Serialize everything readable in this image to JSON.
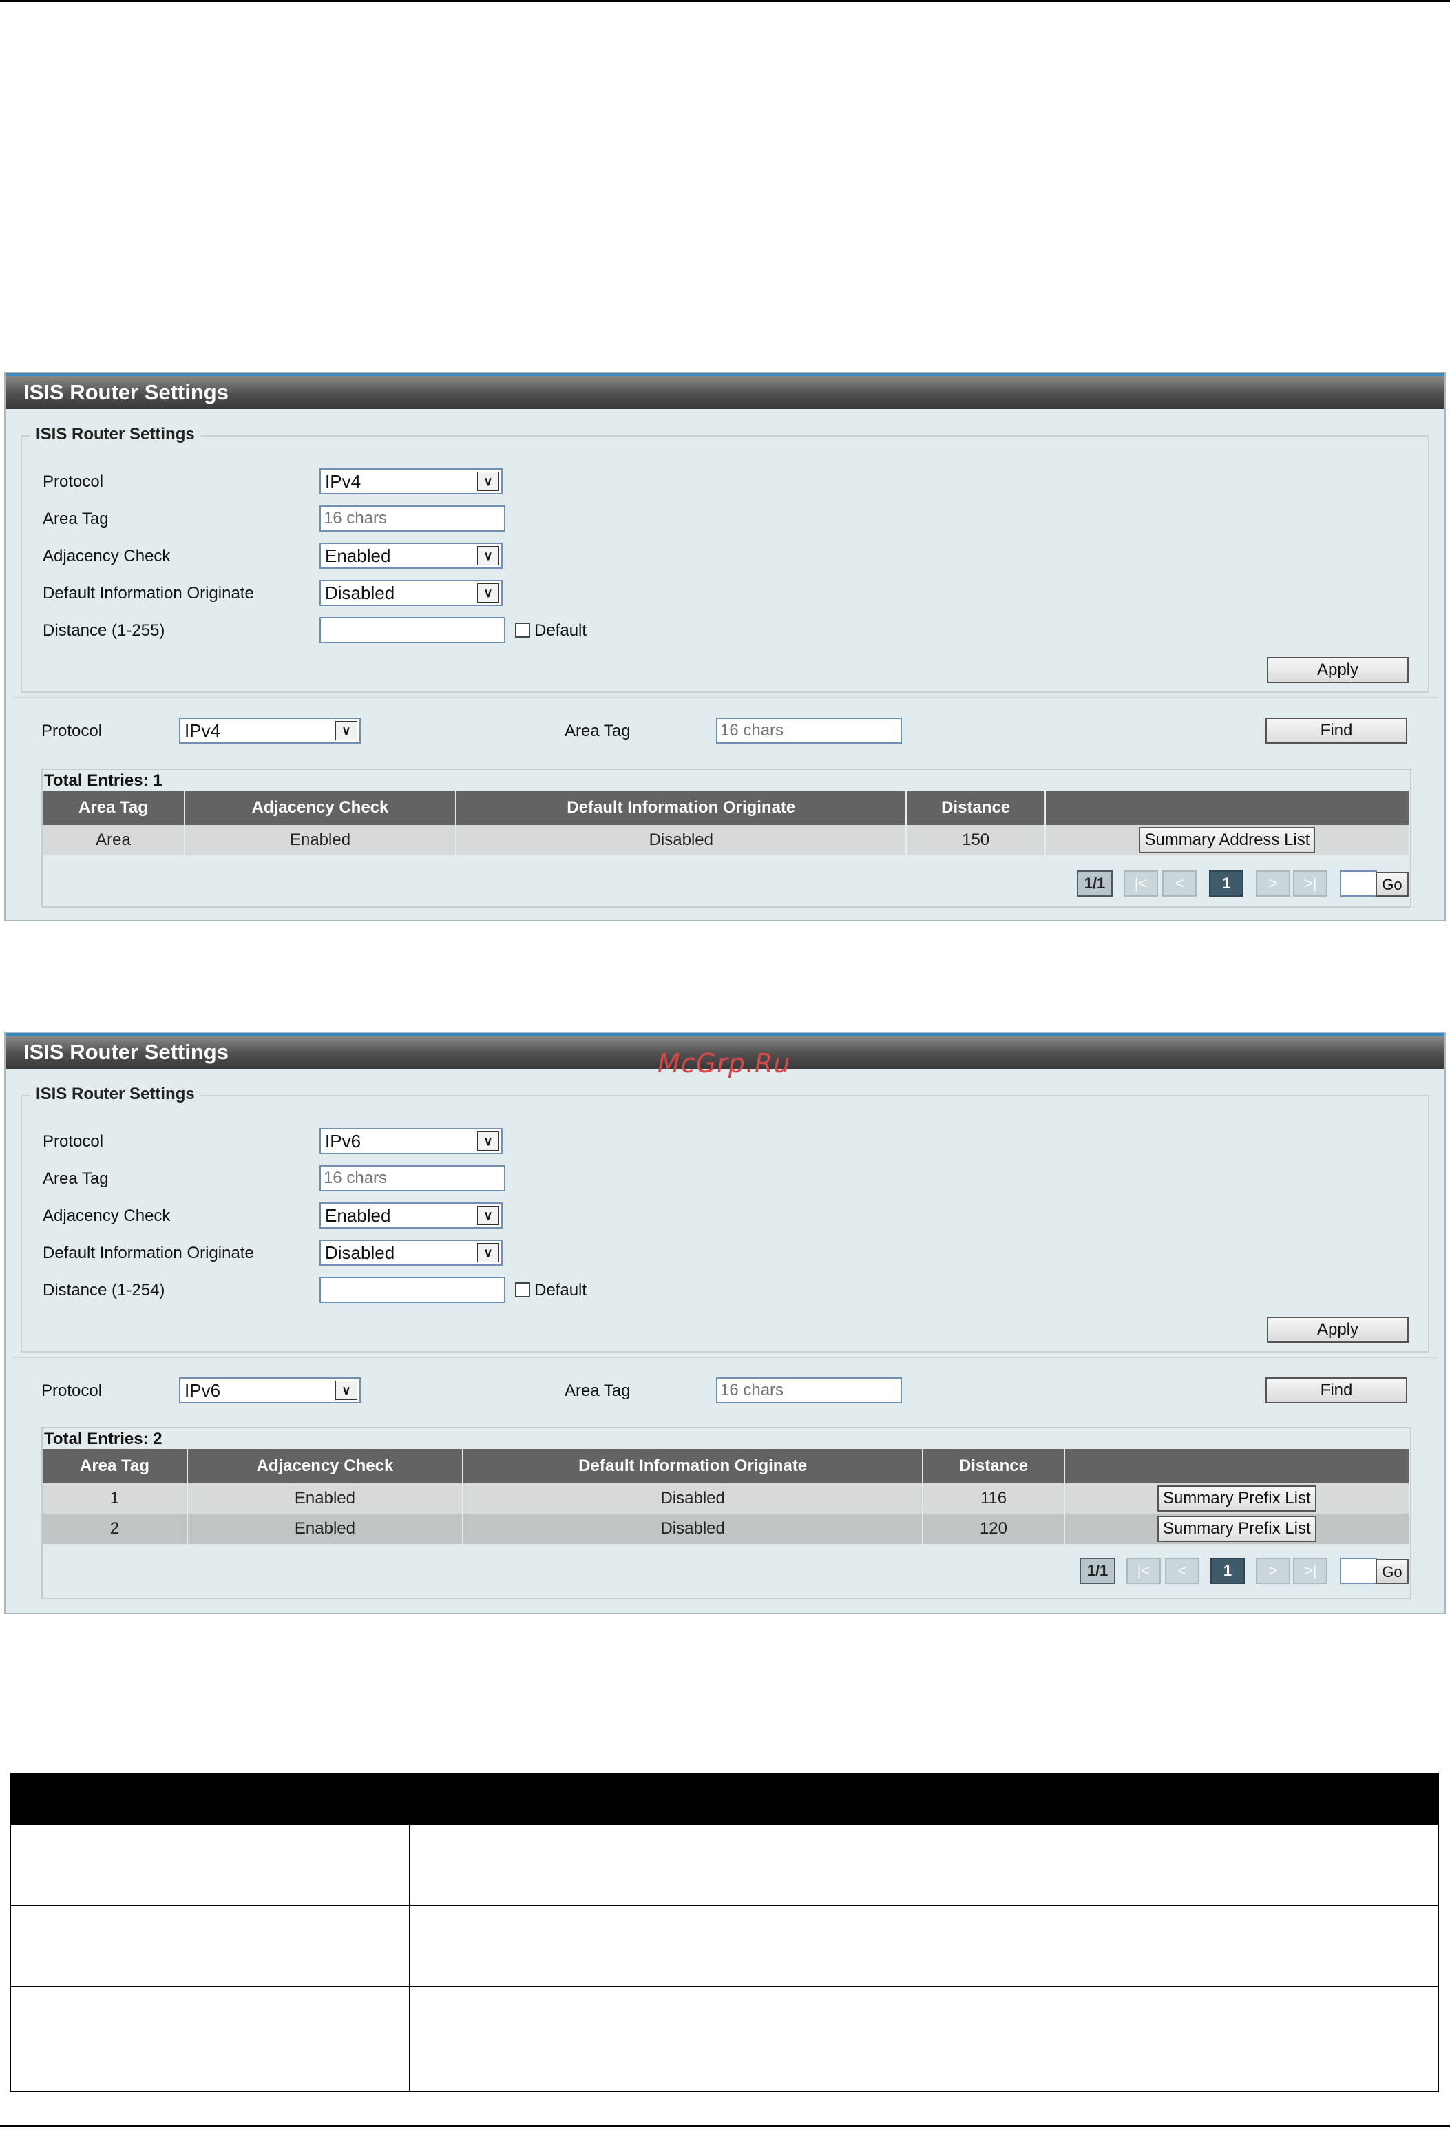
{
  "watermark": "McGrp.Ru",
  "panels": [
    {
      "header": "ISIS Router Settings",
      "legend": "ISIS Router Settings",
      "form": {
        "protocol_label": "Protocol",
        "protocol_value": "IPv4",
        "area_tag_label": "Area Tag",
        "area_tag_placeholder": "16 chars",
        "adjacency_label": "Adjacency Check",
        "adjacency_value": "Enabled",
        "default_info_label": "Default Information Originate",
        "default_info_value": "Disabled",
        "distance_label": "Distance (1-255)",
        "default_checkbox_label": "Default",
        "apply_label": "Apply"
      },
      "find": {
        "protocol_label": "Protocol",
        "protocol_value": "IPv4",
        "area_tag_label": "Area Tag",
        "area_tag_placeholder": "16 chars",
        "find_label": "Find"
      },
      "total_entries": "Total Entries: 1",
      "columns": [
        "Area Tag",
        "Adjacency Check",
        "Default Information Originate",
        "Distance",
        ""
      ],
      "rows": [
        {
          "area_tag": "Area",
          "adjacency": "Enabled",
          "default_info": "Disabled",
          "distance": "150",
          "action": "Summary Address List"
        }
      ],
      "pager": {
        "count": "1/1",
        "first": "|<",
        "prev": "<",
        "current": "1",
        "next": ">",
        "last": ">|",
        "go": "Go"
      }
    },
    {
      "header": "ISIS Router Settings",
      "legend": "ISIS Router Settings",
      "form": {
        "protocol_label": "Protocol",
        "protocol_value": "IPv6",
        "area_tag_label": "Area Tag",
        "area_tag_placeholder": "16 chars",
        "adjacency_label": "Adjacency Check",
        "adjacency_value": "Enabled",
        "default_info_label": "Default Information Originate",
        "default_info_value": "Disabled",
        "distance_label": "Distance (1-254)",
        "default_checkbox_label": "Default",
        "apply_label": "Apply"
      },
      "find": {
        "protocol_label": "Protocol",
        "protocol_value": "IPv6",
        "area_tag_label": "Area Tag",
        "area_tag_placeholder": "16 chars",
        "find_label": "Find"
      },
      "total_entries": "Total Entries: 2",
      "columns": [
        "Area Tag",
        "Adjacency Check",
        "Default Information Originate",
        "Distance",
        ""
      ],
      "rows": [
        {
          "area_tag": "1",
          "adjacency": "Enabled",
          "default_info": "Disabled",
          "distance": "116",
          "action": "Summary Prefix List"
        },
        {
          "area_tag": "2",
          "adjacency": "Enabled",
          "default_info": "Disabled",
          "distance": "120",
          "action": "Summary Prefix List"
        }
      ],
      "pager": {
        "count": "1/1",
        "first": "|<",
        "prev": "<",
        "current": "1",
        "next": ">",
        "last": ">|",
        "go": "Go"
      }
    }
  ]
}
